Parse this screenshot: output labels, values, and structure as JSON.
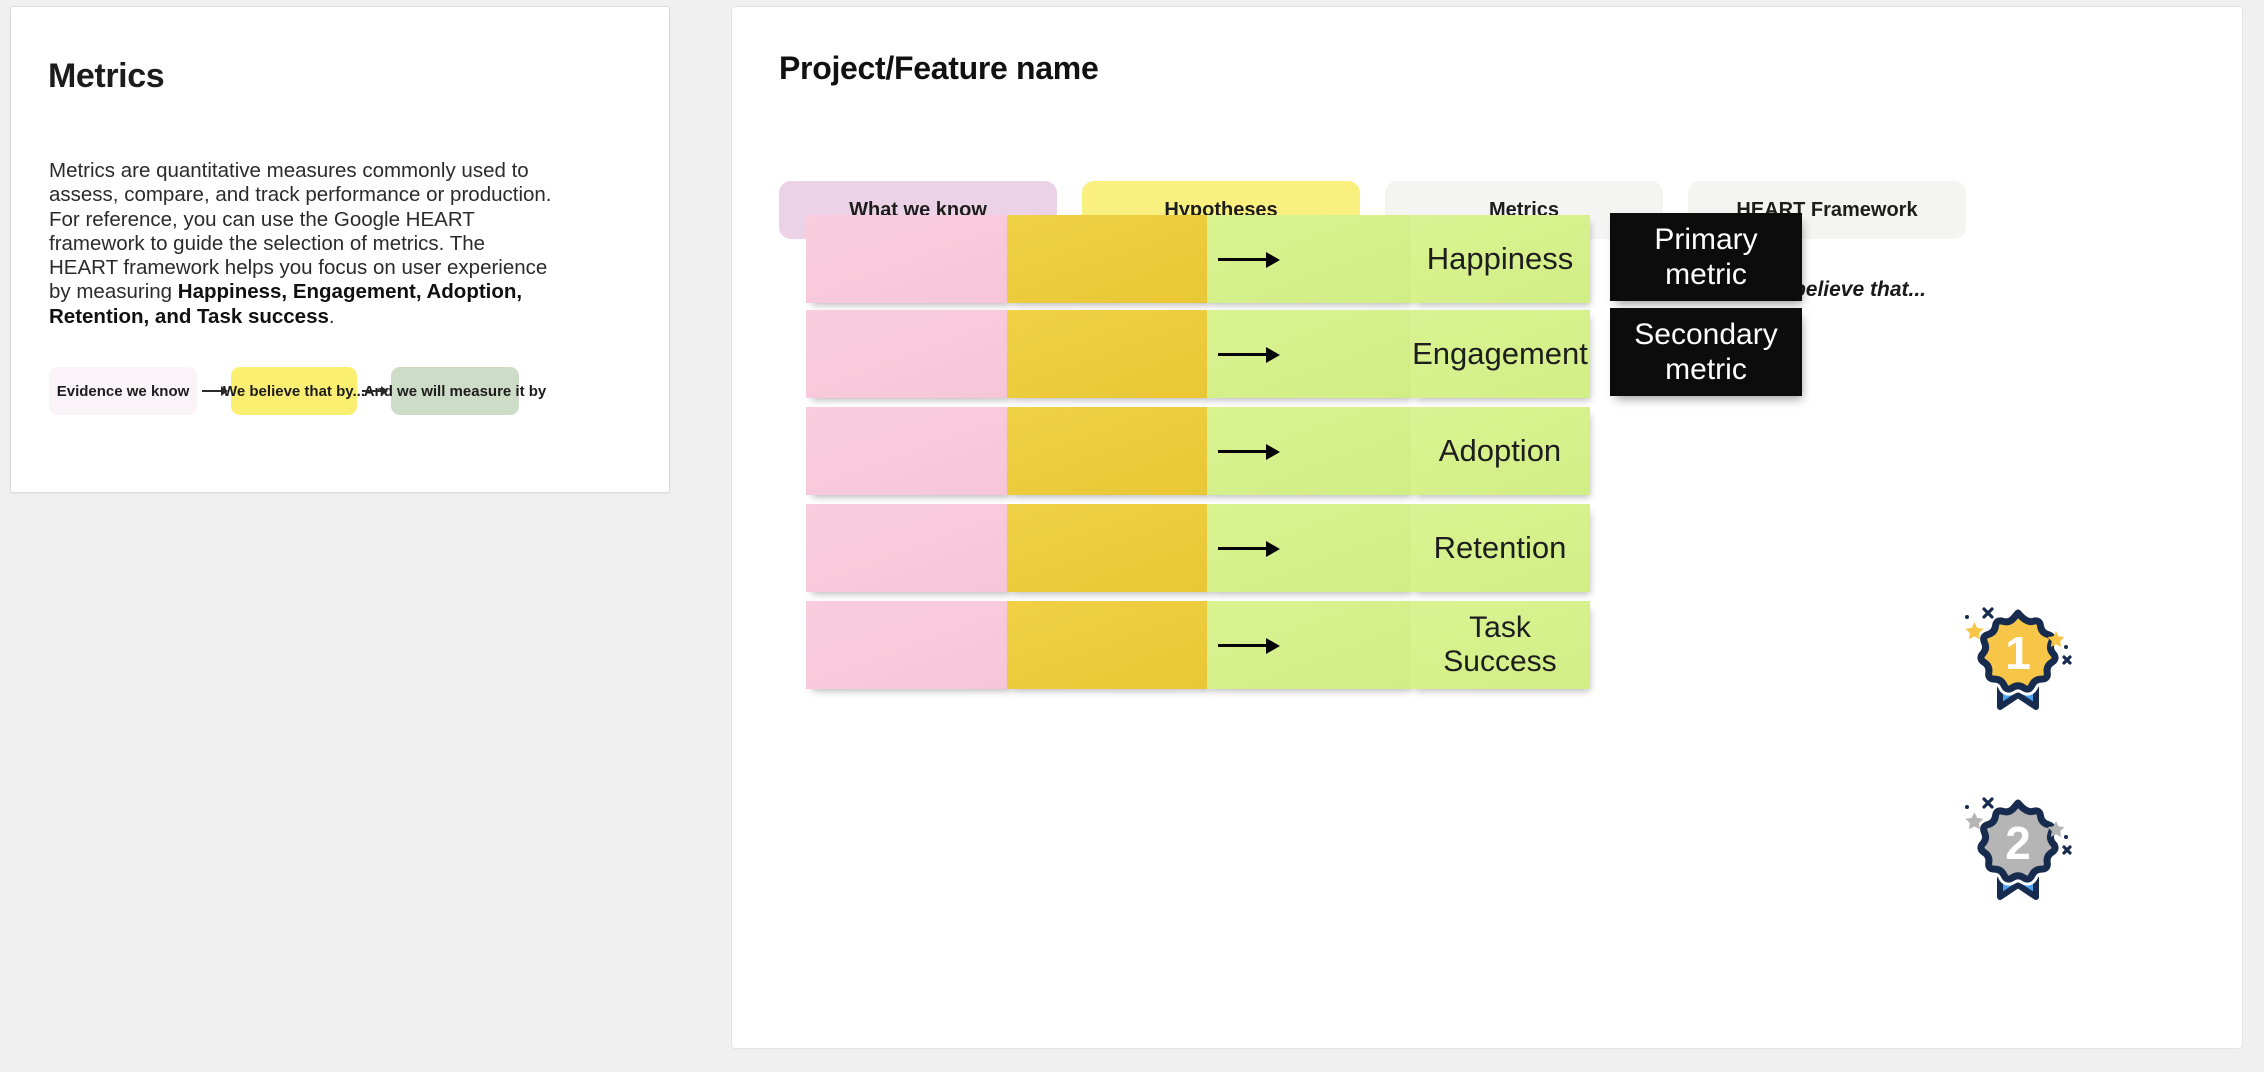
{
  "info_card": {
    "title": "Metrics",
    "paragraph_prefix": "Metrics are quantitative measures commonly used to assess, compare, and track performance or production.\nFor reference, you can use the Google HEART framework to guide the selection of metrics. The HEART framework helps you focus on user experience by measuring ",
    "paragraph_bold": "Happiness, Engagement, Adoption, Retention, and Task success",
    "paragraph_suffix": ".",
    "flow": [
      {
        "label": "Evidence we know",
        "color": "#faf3f7"
      },
      {
        "label": "We believe that by...",
        "color": "#fbef72"
      },
      {
        "label": "And we will measure it by",
        "color": "#ccdcc6"
      }
    ],
    "arrow_icon": "arrow-right-icon"
  },
  "board": {
    "title": "Project/Feature name",
    "tabs": [
      {
        "label": "What we know",
        "color": "#ecd2e7"
      },
      {
        "label": "Hypotheses",
        "color": "#faf07f"
      },
      {
        "label": "Metrics",
        "color": "#f4f5f2"
      },
      {
        "label": "HEART Framework",
        "color": "#f4f5f2"
      }
    ],
    "believe_label": "We believe that...",
    "columns": {
      "what_we_know": {
        "color": "#f7c9db",
        "count": 5,
        "notes": [
          "",
          "",
          "",
          "",
          ""
        ]
      },
      "hypotheses": {
        "color": "#eecd3f",
        "count": 5,
        "notes": [
          "",
          "",
          "",
          "",
          ""
        ]
      },
      "metrics": {
        "color": "#d4ee8c",
        "count": 5,
        "notes": [
          "",
          "",
          "",
          "",
          ""
        ]
      },
      "heart": {
        "color": "#d4ee8c",
        "labels": [
          "Happiness",
          "Engagement",
          "Adoption",
          "Retention",
          "Task Success"
        ]
      },
      "priority": {
        "badges": [
          {
            "label": "Primary metric",
            "color": "#0c0c0c"
          },
          {
            "label": "Secondary metric",
            "color": "#0c0c0c"
          }
        ],
        "medals": [
          {
            "rank": "1",
            "name": "gold-medal-icon",
            "face": "#f7c648",
            "outline": "#162b4d",
            "ribbon": "#4aa3ef",
            "sparkle": "#f7c648"
          },
          {
            "rank": "2",
            "name": "silver-medal-icon",
            "face": "#b5b5b5",
            "outline": "#162b4d",
            "ribbon": "#4aa3ef",
            "sparkle": "#b5b5b5"
          }
        ]
      }
    },
    "arrow_icon": "arrow-right-icon"
  }
}
